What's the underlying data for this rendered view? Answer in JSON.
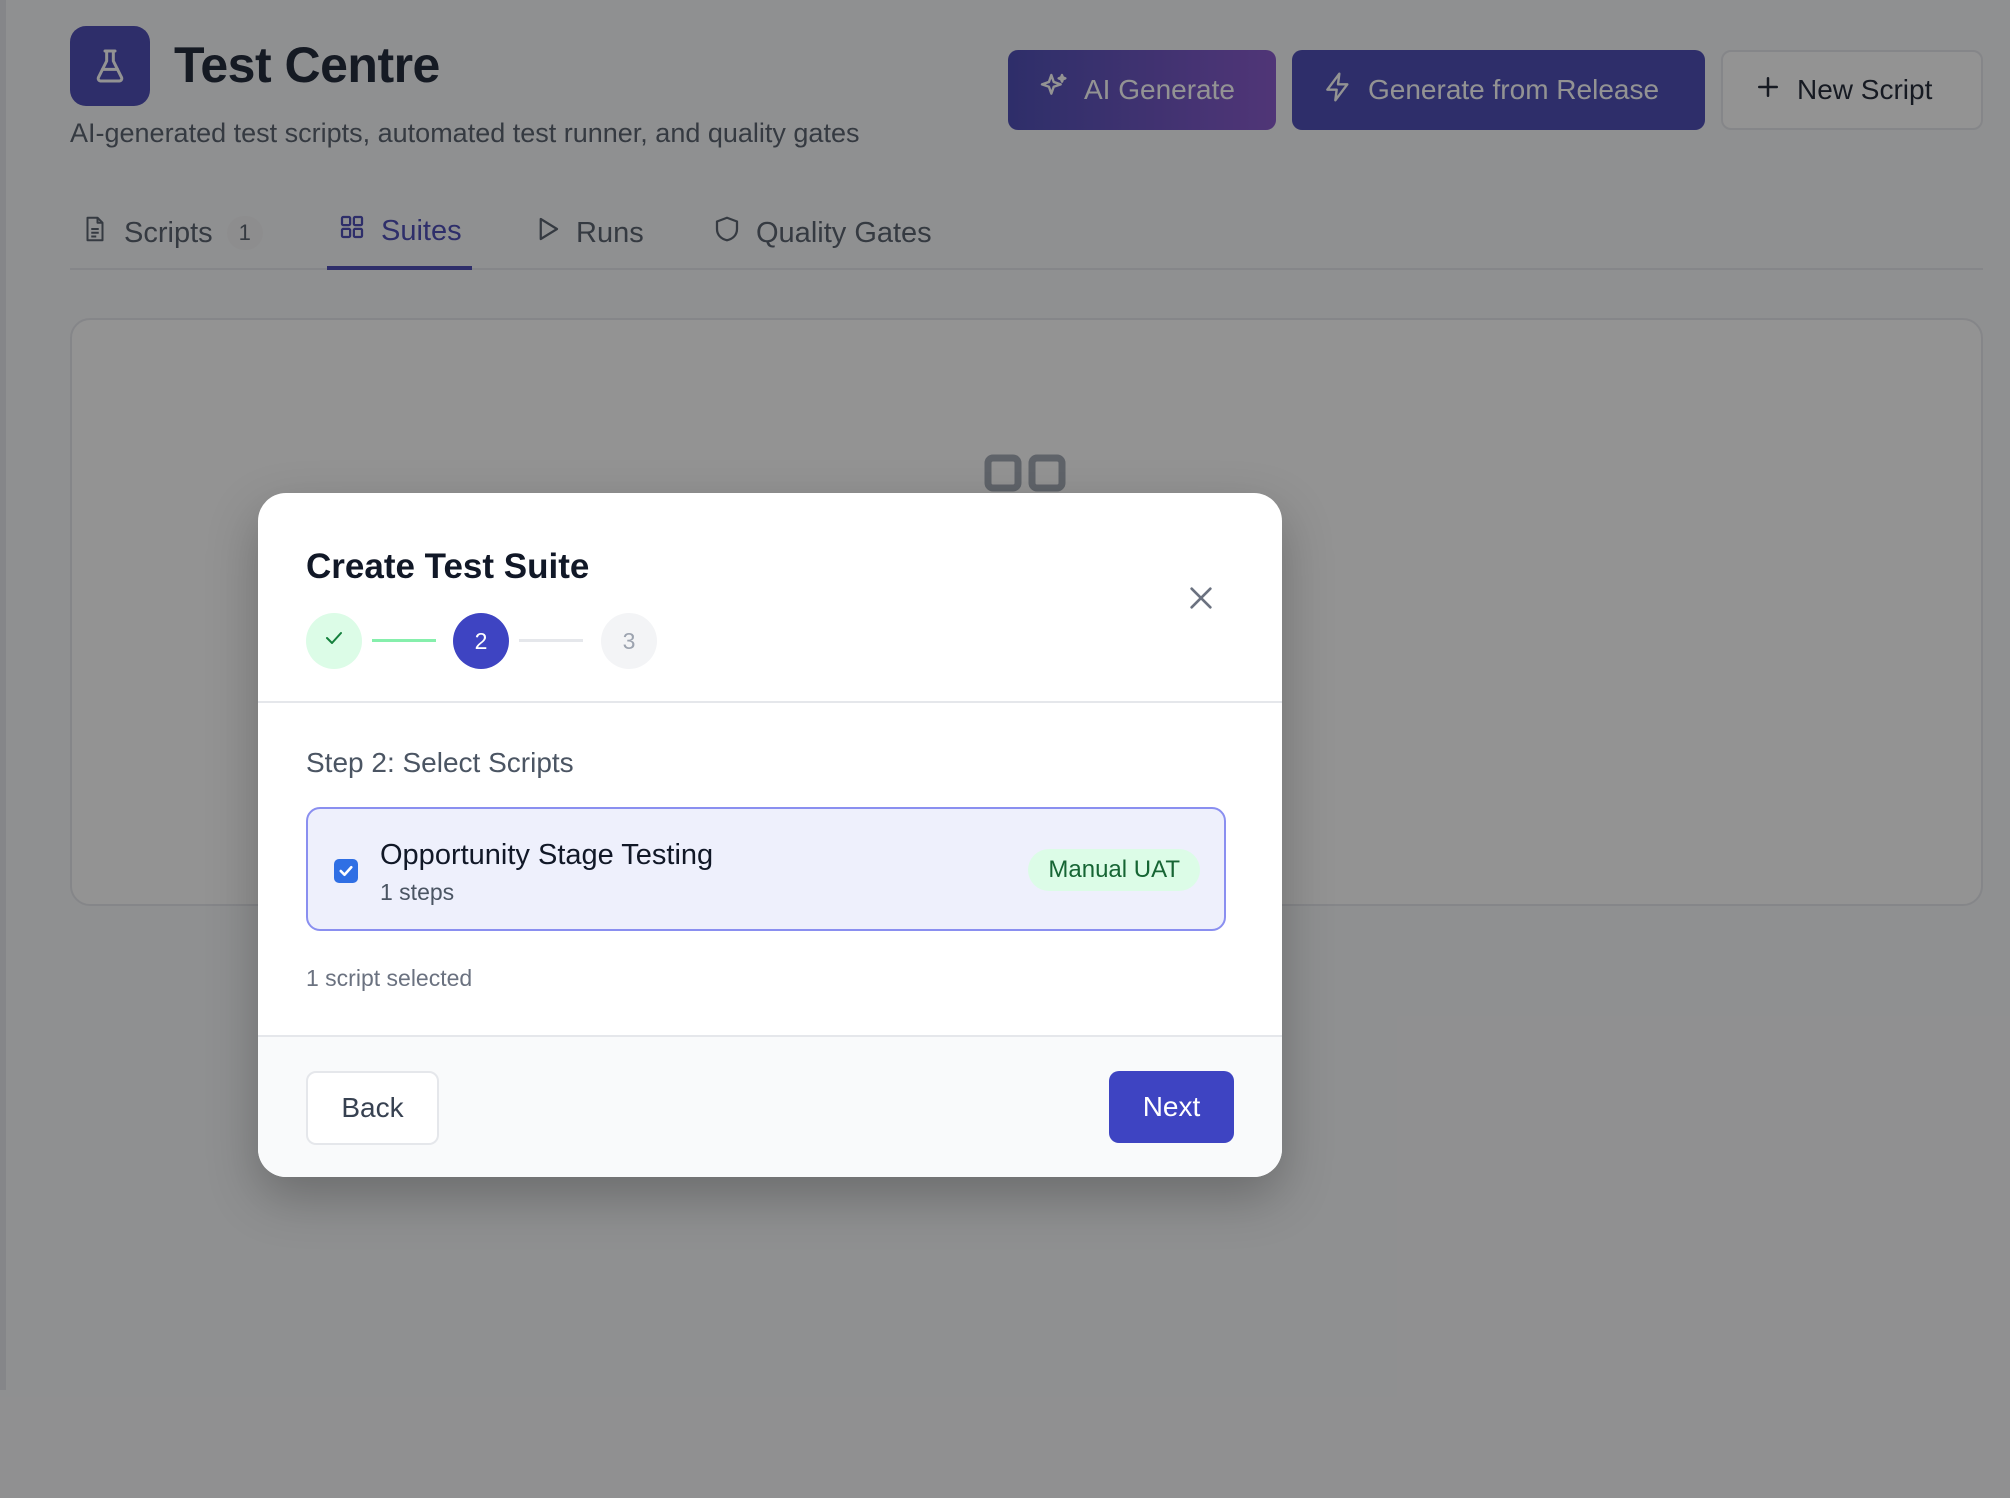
{
  "header": {
    "title": "Test Centre",
    "subtitle": "AI-generated test scripts, automated test runner, and quality gates",
    "icon": "flask-icon",
    "actions": {
      "ai_generate": "AI Generate",
      "generate_release": "Generate from Release",
      "new_script": "New Script"
    }
  },
  "tabs": [
    {
      "label": "Scripts",
      "badge": "1",
      "icon": "document-icon"
    },
    {
      "label": "Suites",
      "icon": "grid-icon",
      "active": true
    },
    {
      "label": "Runs",
      "icon": "play-icon"
    },
    {
      "label": "Quality Gates",
      "icon": "shield-icon"
    }
  ],
  "modal": {
    "title": "Create Test Suite",
    "stepper": {
      "step1": "done",
      "step2": "2",
      "step3": "3"
    },
    "step_heading": "Step 2: Select Scripts",
    "scripts": [
      {
        "name": "Opportunity Stage Testing",
        "steps": "1 steps",
        "badge": "Manual UAT",
        "checked": true
      }
    ],
    "selected_count": "1 script selected",
    "back_label": "Back",
    "next_label": "Next"
  },
  "colors": {
    "accent": "#3e3fb0",
    "primary_button": "#3e44c2",
    "success_bg": "#dcfce7",
    "success_text": "#166534",
    "selected_bg": "#eef0fc",
    "selected_border": "#8a8ff0"
  }
}
